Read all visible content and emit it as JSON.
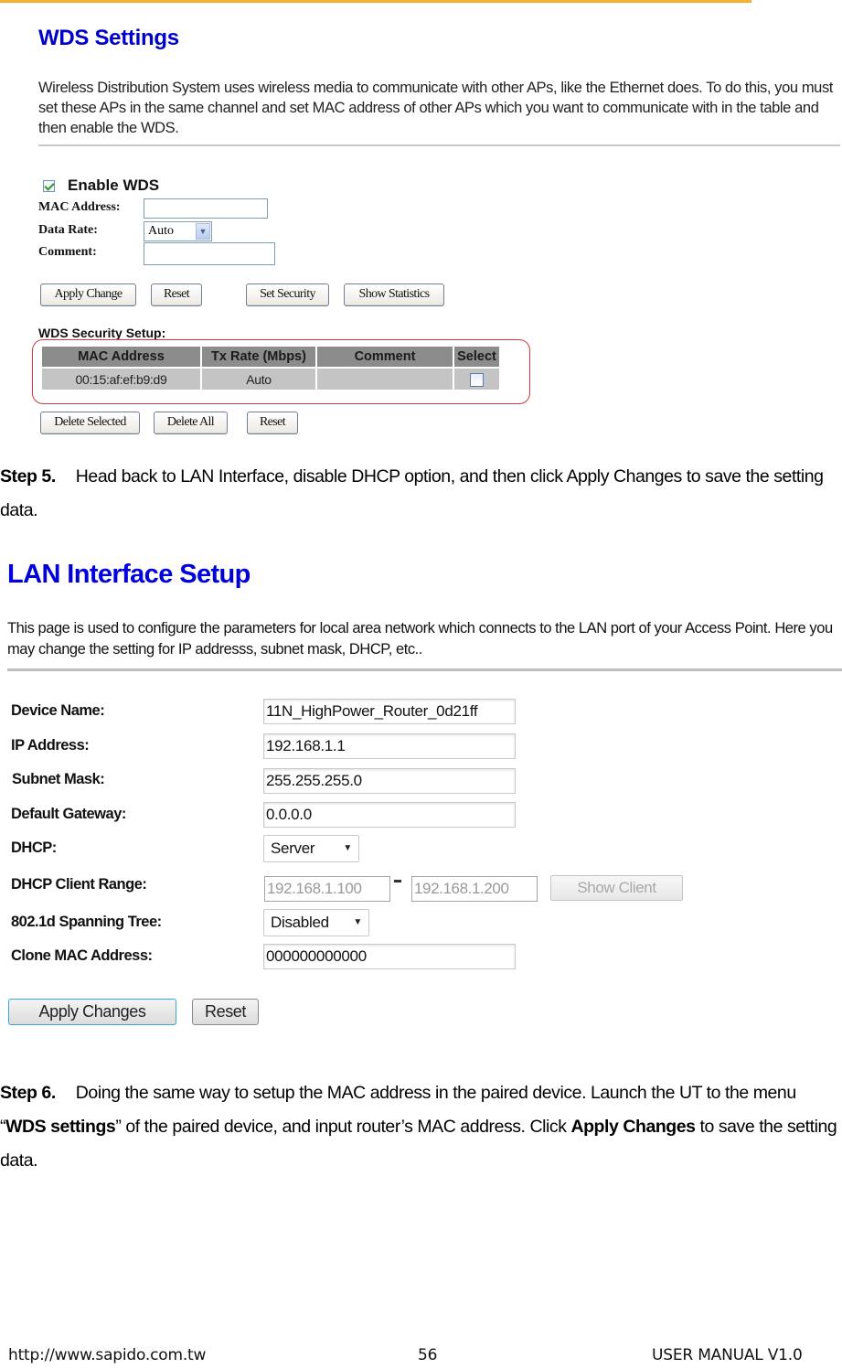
{
  "wds_settings": {
    "title": "WDS Settings",
    "description": "Wireless Distribution System uses wireless media to communicate with other APs, like the Ethernet does. To do this, you must set these APs in the same channel and set MAC address of other APs which you want to communicate with in the table and then enable the WDS.",
    "enable_wds": {
      "label": "Enable WDS",
      "checked": true
    },
    "fields": {
      "mac_address": {
        "label": "MAC Address:",
        "value": ""
      },
      "data_rate": {
        "label": "Data Rate:",
        "value": "Auto"
      },
      "comment": {
        "label": "Comment:",
        "value": ""
      }
    },
    "buttons": {
      "apply_change": "Apply Change",
      "reset": "Reset",
      "set_security": "Set Security",
      "show_statistics": "Show Statistics"
    },
    "security_setup": {
      "title": "WDS Security Setup:",
      "columns": [
        "MAC Address",
        "Tx Rate (Mbps)",
        "Comment",
        "Select"
      ],
      "rows": [
        {
          "mac": "00:15:af:ef:b9:d9",
          "tx_rate": "Auto",
          "comment": "",
          "selected": false
        }
      ],
      "highlight_color": "#d9373b"
    },
    "table_buttons": {
      "delete_selected": "Delete Selected",
      "delete_all": "Delete All",
      "reset": "Reset"
    }
  },
  "step5": {
    "label": "Step 5.",
    "text": "Head back to LAN Interface, disable DHCP option, and then click Apply Changes to save the setting data."
  },
  "lan_setup": {
    "title": "LAN Interface Setup",
    "description": "This page is used to configure the parameters for local area network which connects to the LAN port of your Access Point. Here you may change the setting for IP addresss, subnet mask, DHCP, etc..",
    "fields": {
      "device_name": {
        "label": "Device Name:",
        "value": "11N_HighPower_Router_0d21ff"
      },
      "ip_address": {
        "label": "IP Address:",
        "value": "192.168.1.1"
      },
      "subnet_mask": {
        "label": "Subnet Mask:",
        "value": "255.255.255.0"
      },
      "default_gateway": {
        "label": "Default Gateway:",
        "value": "0.0.0.0"
      },
      "dhcp": {
        "label": "DHCP:",
        "value": "Server"
      },
      "dhcp_range": {
        "label": "DHCP Client Range:",
        "start": "192.168.1.100",
        "end": "192.168.1.200",
        "show_client": "Show Client"
      },
      "spanning_tree": {
        "label": "802.1d Spanning Tree:",
        "value": "Disabled"
      },
      "clone_mac": {
        "label": "Clone MAC Address:",
        "value": "000000000000"
      }
    },
    "buttons": {
      "apply_changes": "Apply Changes",
      "reset": "Reset"
    },
    "title_color": "#0000dd"
  },
  "step6": {
    "label": "Step 6.",
    "text_1": "Doing the same way to setup the MAC address in the paired device. Launch the UT to the menu “",
    "bold_1": "WDS settings",
    "text_2": "” of the paired device, and input router’s MAC address. Click ",
    "bold_2": "Apply Changes",
    "text_3": " to save the setting data."
  },
  "footer": {
    "url": "http://www.sapido.com.tw",
    "page_number": "56",
    "manual": "USER MANUAL V1.0"
  }
}
